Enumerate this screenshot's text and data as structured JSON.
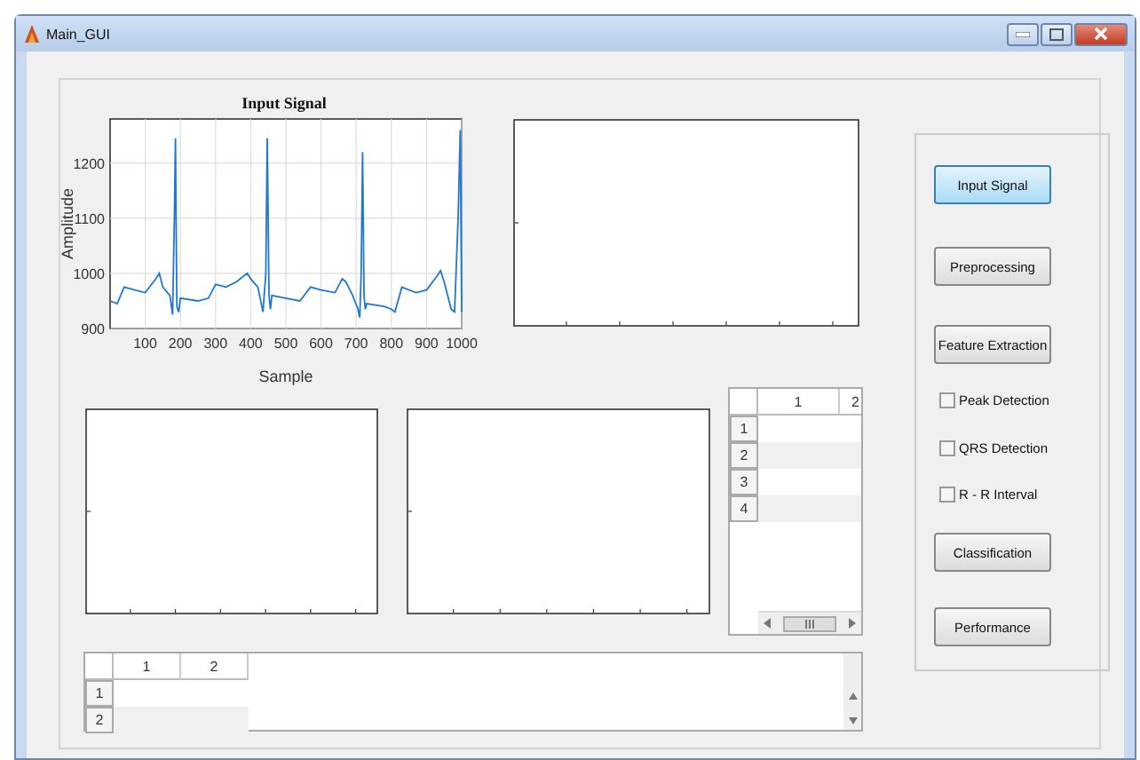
{
  "window": {
    "title": "Main_GUI"
  },
  "input_plot": {
    "chart_data": {
      "type": "line",
      "title": "Input Signal",
      "xlabel": "Sample",
      "ylabel": "Amplitude",
      "xlim": [
        0,
        1000
      ],
      "ylim": [
        900,
        1280
      ],
      "xticks": [
        100,
        200,
        300,
        400,
        500,
        600,
        700,
        800,
        900,
        1000
      ],
      "yticks": [
        900,
        1000,
        1100,
        1200
      ],
      "grid": true,
      "series": [
        {
          "color": "#1f77d4",
          "x": [
            1,
            20,
            40,
            70,
            100,
            130,
            140,
            150,
            170,
            178,
            183,
            186,
            190,
            195,
            200,
            250,
            280,
            300,
            330,
            360,
            390,
            400,
            420,
            435,
            443,
            447,
            452,
            456,
            460,
            500,
            540,
            570,
            600,
            640,
            660,
            670,
            690,
            705,
            710,
            714,
            718,
            722,
            726,
            730,
            780,
            800,
            810,
            830,
            870,
            900,
            930,
            940,
            950,
            970,
            980,
            990,
            996,
            1000
          ],
          "values": [
            950,
            945,
            975,
            970,
            965,
            990,
            1000,
            975,
            960,
            925,
            1100,
            1245,
            940,
            930,
            955,
            950,
            955,
            980,
            975,
            985,
            1000,
            990,
            975,
            930,
            1000,
            1245,
            960,
            935,
            960,
            955,
            950,
            975,
            970,
            965,
            990,
            985,
            960,
            935,
            920,
            1000,
            1220,
            960,
            935,
            945,
            940,
            935,
            930,
            975,
            965,
            970,
            995,
            1005,
            985,
            935,
            930,
            1100,
            1260,
            930
          ]
        }
      ]
    }
  },
  "small_table": {
    "columns": [
      "1",
      "2"
    ],
    "row_headers": [
      "1",
      "2",
      "3",
      "4"
    ]
  },
  "bottom_table": {
    "columns": [
      "1",
      "2"
    ],
    "row_headers": [
      "1",
      "2"
    ]
  },
  "controls": [
    {
      "kind": "button",
      "label": "Input Signal",
      "focused": true
    },
    {
      "kind": "button",
      "label": "Preprocessing",
      "focused": false
    },
    {
      "kind": "button",
      "label": "Feature Extraction",
      "focused": false
    },
    {
      "kind": "checkbox",
      "label": "Peak Detection",
      "checked": false
    },
    {
      "kind": "checkbox",
      "label": "QRS Detection",
      "checked": false
    },
    {
      "kind": "checkbox",
      "label": "R - R Interval",
      "checked": false
    },
    {
      "kind": "button",
      "label": "Classification",
      "focused": false
    },
    {
      "kind": "button",
      "label": "Performance",
      "focused": false
    }
  ]
}
